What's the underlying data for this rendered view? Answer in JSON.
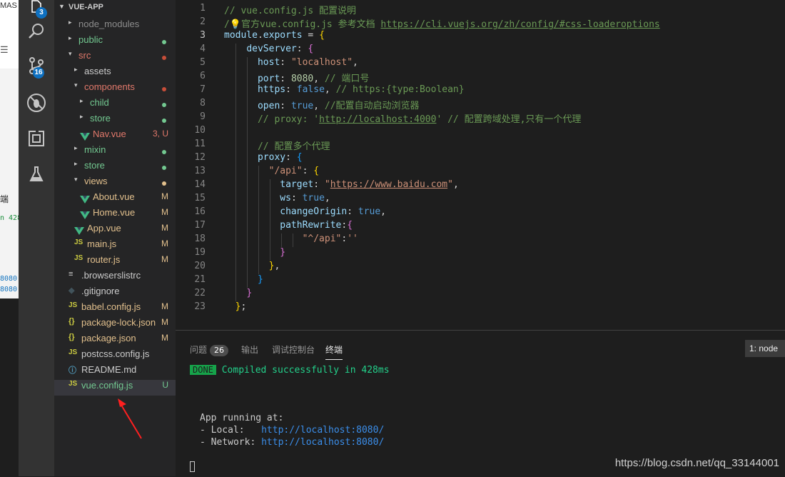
{
  "left_strip": {
    "t1": "MAS",
    "t2": "☰",
    "t3": "端",
    "t4": "n 428",
    "t5": "8080,",
    "t6": "8080"
  },
  "activity_bar": {
    "explorer_badge": "3",
    "scm_badge": "16",
    "icons": [
      "files-icon",
      "search-icon",
      "source-control-icon",
      "debug-icon",
      "extensions-icon",
      "test-flask-icon"
    ]
  },
  "sidebar": {
    "title": "VUE-APP",
    "items": [
      {
        "name": "node_modules",
        "status": "",
        "dot": "",
        "color": "#8c8c8c"
      },
      {
        "name": "public",
        "status": "",
        "dot": "#73c991",
        "color": "#73c991"
      },
      {
        "name": "src",
        "status": "",
        "dot": "#c74e39",
        "color": "#e2796b"
      },
      {
        "name": "assets",
        "status": "",
        "dot": "",
        "color": "#cccccc"
      },
      {
        "name": "components",
        "status": "",
        "dot": "#c74e39",
        "color": "#e2796b"
      },
      {
        "name": "child",
        "status": "",
        "dot": "#73c991",
        "color": "#73c991"
      },
      {
        "name": "store",
        "status": "",
        "dot": "#73c991",
        "color": "#73c991"
      },
      {
        "name": "Nav.vue",
        "status": "3, U",
        "dot": "",
        "color": "#e2796b"
      },
      {
        "name": "mixin",
        "status": "",
        "dot": "#73c991",
        "color": "#73c991"
      },
      {
        "name": "store",
        "status": "",
        "dot": "#73c991",
        "color": "#73c991"
      },
      {
        "name": "views",
        "status": "",
        "dot": "#e2c08d",
        "color": "#e2c08d"
      },
      {
        "name": "About.vue",
        "status": "M",
        "dot": "",
        "color": "#e2c08d"
      },
      {
        "name": "Home.vue",
        "status": "M",
        "dot": "",
        "color": "#e2c08d"
      },
      {
        "name": "App.vue",
        "status": "M",
        "dot": "",
        "color": "#e2c08d"
      },
      {
        "name": "main.js",
        "status": "M",
        "dot": "",
        "color": "#e2c08d"
      },
      {
        "name": "router.js",
        "status": "M",
        "dot": "",
        "color": "#e2c08d"
      },
      {
        "name": ".browserslistrc",
        "status": "",
        "dot": "",
        "color": "#cccccc"
      },
      {
        "name": ".gitignore",
        "status": "",
        "dot": "",
        "color": "#cccccc"
      },
      {
        "name": "babel.config.js",
        "status": "M",
        "dot": "",
        "color": "#e2c08d"
      },
      {
        "name": "package-lock.json",
        "status": "M",
        "dot": "",
        "color": "#e2c08d"
      },
      {
        "name": "package.json",
        "status": "M",
        "dot": "",
        "color": "#e2c08d"
      },
      {
        "name": "postcss.config.js",
        "status": "",
        "dot": "",
        "color": "#cccccc"
      },
      {
        "name": "README.md",
        "status": "",
        "dot": "",
        "color": "#cccccc"
      },
      {
        "name": "vue.config.js",
        "status": "U",
        "dot": "",
        "color": "#73c991"
      }
    ]
  },
  "editor": {
    "line_numbers": [
      "1",
      "2",
      "3",
      "4",
      "5",
      "6",
      "7",
      "8",
      "9",
      "10",
      "11",
      "12",
      "13",
      "14",
      "15",
      "16",
      "17",
      "18",
      "19",
      "20",
      "21",
      "22",
      "23"
    ],
    "code": {
      "l1": "// vue.config.js 配置说明",
      "l2a": "/",
      "l2b": "官方vue.config.js 参考文档 ",
      "l2c": "https://cli.vuejs.org/zh/config/#css-loaderoptions",
      "l3a": "module",
      "l3b": ".",
      "l3c": "exports",
      "l3d": " = ",
      "l3e": "{",
      "l4a": "devServer",
      "l4b": ": ",
      "l4c": "{",
      "l5a": "host",
      "l5b": ": ",
      "l5c": "\"localhost\"",
      "l5d": ",",
      "l6a": "port",
      "l6b": ": ",
      "l6c": "8080",
      "l6d": ", ",
      "l6e": "// 端口号",
      "l7a": "https",
      "l7b": ": ",
      "l7c": "false",
      "l7d": ", ",
      "l7e": "// https:{type:Boolean}",
      "l8a": "open",
      "l8b": ": ",
      "l8c": "true",
      "l8d": ", ",
      "l8e": "//配置自动启动浏览器",
      "l9a": "// proxy: '",
      "l9b": "http://localhost:4000",
      "l9c": "' // 配置跨域处理,只有一个代理",
      "l11": "// 配置多个代理",
      "l12a": "proxy",
      "l12b": ": ",
      "l12c": "{",
      "l13a": "\"/api\"",
      "l13b": ": ",
      "l13c": "{",
      "l14a": "target",
      "l14b": ": ",
      "l14c": "\"",
      "l14d": "https://www.baidu.com",
      "l14e": "\"",
      "l14f": ",",
      "l15a": "ws",
      "l15b": ": ",
      "l15c": "true",
      "l15d": ",",
      "l16a": "changeOrigin",
      "l16b": ": ",
      "l16c": "true",
      "l16d": ",",
      "l17a": "pathRewrite",
      "l17b": ":",
      "l17c": "{",
      "l18a": "\"^/api\"",
      "l18b": ":",
      "l18c": "''",
      "l19": "}",
      "l20a": "}",
      "l20b": ",",
      "l21": "}",
      "l22": "}",
      "l23a": "}",
      "l23b": ";"
    }
  },
  "panel": {
    "tabs": [
      "问题",
      "输出",
      "调试控制台",
      "终端"
    ],
    "problems_count": "26",
    "terminal_select": "1: node",
    "done_label": "DONE",
    "compiled": "Compiled successfully in 428ms",
    "app_running": "App running at:",
    "local_label": "- Local:   ",
    "local_url": "http://localhost:8080/",
    "network_label": "- Network: ",
    "network_url": "http://localhost:8080/"
  },
  "watermark": "https://blog.csdn.net/qq_33144001",
  "colors": {
    "activity_bg": "#333333",
    "sidebar_bg": "#252526",
    "editor_bg": "#1e1e1e",
    "badge_blue": "#0e70c0",
    "annotation_red": "#ff2020"
  }
}
